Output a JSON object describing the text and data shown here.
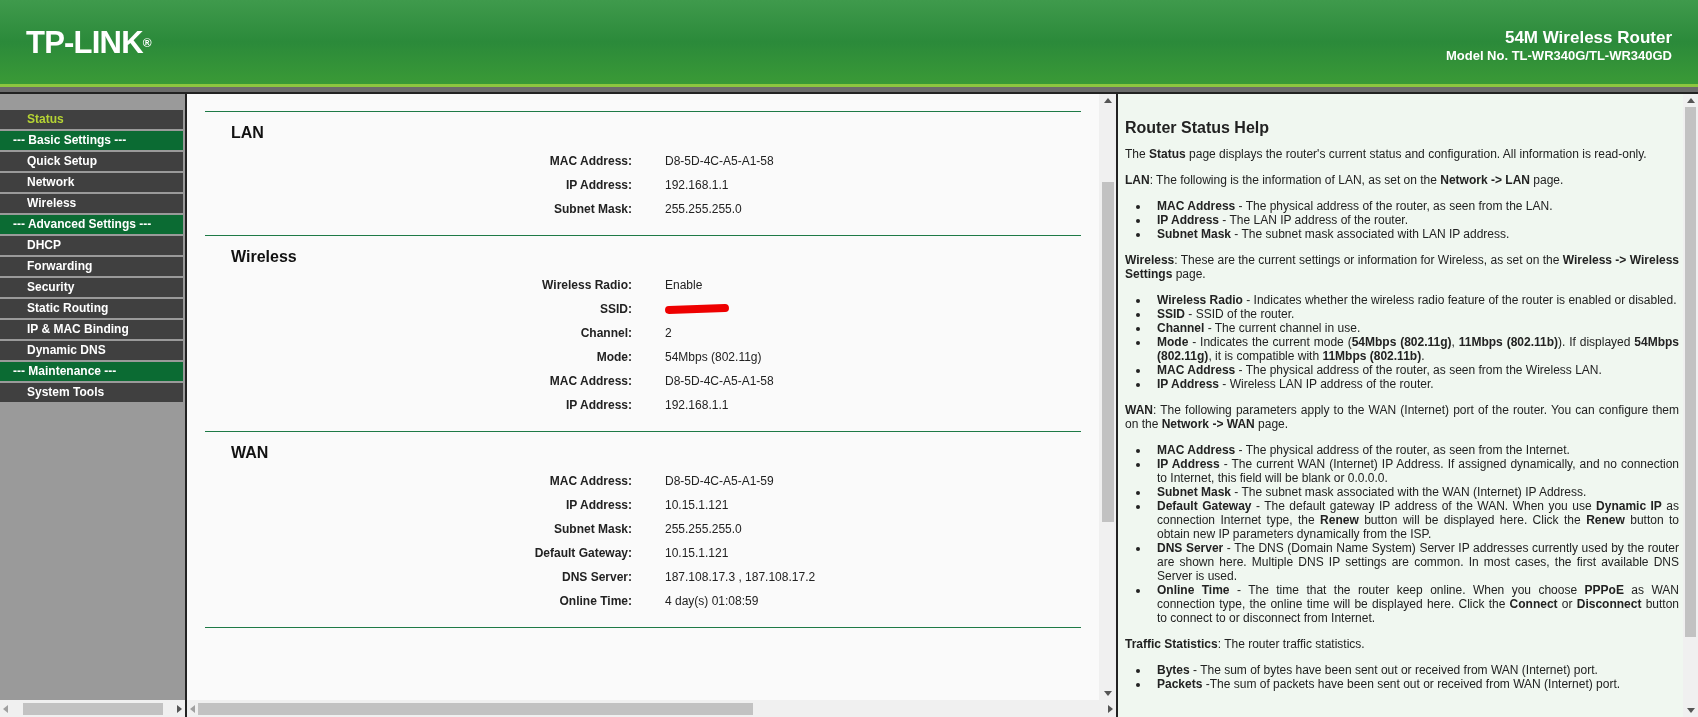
{
  "header": {
    "logo": "TP-LINK",
    "logo_mark": "®",
    "product": "54M Wireless Router",
    "model": "Model No. TL-WR340G/TL-WR340GD"
  },
  "sidebar": {
    "items": [
      {
        "label": "Status",
        "kind": "link",
        "selected": true
      },
      {
        "label": "--- Basic Settings ---",
        "kind": "heading",
        "selected": false
      },
      {
        "label": "Quick Setup",
        "kind": "link",
        "selected": false
      },
      {
        "label": "Network",
        "kind": "link",
        "selected": false
      },
      {
        "label": "Wireless",
        "kind": "link",
        "selected": false
      },
      {
        "label": "--- Advanced Settings ---",
        "kind": "heading",
        "selected": false
      },
      {
        "label": "DHCP",
        "kind": "link",
        "selected": false
      },
      {
        "label": "Forwarding",
        "kind": "link",
        "selected": false
      },
      {
        "label": "Security",
        "kind": "link",
        "selected": false
      },
      {
        "label": "Static Routing",
        "kind": "link",
        "selected": false
      },
      {
        "label": "IP & MAC Binding",
        "kind": "link",
        "selected": false
      },
      {
        "label": "Dynamic DNS",
        "kind": "link",
        "selected": false
      },
      {
        "label": "--- Maintenance ---",
        "kind": "heading",
        "selected": false
      },
      {
        "label": "System Tools",
        "kind": "link",
        "selected": false
      }
    ]
  },
  "main": {
    "sections": [
      {
        "title": "LAN",
        "rows": [
          {
            "label": "MAC Address:",
            "value": "D8-5D-4C-A5-A1-58",
            "redacted": false
          },
          {
            "label": "IP Address:",
            "value": "192.168.1.1",
            "redacted": false
          },
          {
            "label": "Subnet Mask:",
            "value": "255.255.255.0",
            "redacted": false
          }
        ]
      },
      {
        "title": "Wireless",
        "rows": [
          {
            "label": "Wireless Radio:",
            "value": "Enable",
            "redacted": false
          },
          {
            "label": "SSID:",
            "redacted": true
          },
          {
            "label": "Channel:",
            "value": "2",
            "redacted": false
          },
          {
            "label": "Mode:",
            "value": "54Mbps (802.11g)",
            "redacted": false
          },
          {
            "label": "MAC Address:",
            "value": "D8-5D-4C-A5-A1-58",
            "redacted": false
          },
          {
            "label": "IP Address:",
            "value": "192.168.1.1",
            "redacted": false
          }
        ]
      },
      {
        "title": "WAN",
        "rows": [
          {
            "label": "MAC Address:",
            "value": "D8-5D-4C-A5-A1-59",
            "redacted": false
          },
          {
            "label": "IP Address:",
            "value": "10.15.1.121",
            "redacted": false
          },
          {
            "label": "Subnet Mask:",
            "value": "255.255.255.0",
            "redacted": false
          },
          {
            "label": "Default Gateway:",
            "value": "10.15.1.121",
            "redacted": false
          },
          {
            "label": "DNS Server:",
            "value": "187.108.17.3 , 187.108.17.2",
            "redacted": false
          },
          {
            "label": "Online Time:",
            "value": "4 day(s) 01:08:59",
            "redacted": false
          }
        ]
      }
    ]
  },
  "help": {
    "title": "Router Status Help",
    "blocks": [
      {
        "kind": "paragraph",
        "text": "The **Status** page displays the router's current status and configuration. All information is read-only."
      },
      {
        "kind": "paragraph",
        "text": "**LAN**: The following is the information of LAN, as set on the **Network -> LAN** page."
      },
      {
        "kind": "list",
        "items": [
          "**MAC Address** - The physical address of the router, as seen from the LAN.",
          "**IP Address** - The LAN IP address of the router.",
          "**Subnet Mask** - The subnet mask associated with LAN IP address."
        ]
      },
      {
        "kind": "paragraph",
        "text": "**Wireless**: These are the current settings or information for Wireless, as set on the **Wireless -> Wireless Settings** page."
      },
      {
        "kind": "list",
        "items": [
          "**Wireless Radio** - Indicates whether the wireless radio feature of the router is enabled or disabled.",
          "**SSID** - SSID of the router.",
          "**Channel** - The current channel in use.",
          "**Mode** - Indicates the current mode (**54Mbps (802.11g)**, **11Mbps (802.11b)**). If displayed **54Mbps (802.11g)**, it is compatible with **11Mbps (802.11b)**.",
          "**MAC Address** - The physical address of the router, as seen from the Wireless LAN.",
          "**IP Address** - Wireless LAN IP address of the router."
        ]
      },
      {
        "kind": "paragraph",
        "text": "**WAN**: The following parameters apply to the WAN (Internet) port of the router. You can configure them on the **Network -> WAN** page."
      },
      {
        "kind": "list",
        "items": [
          "**MAC Address** - The physical address of the router, as seen from the Internet.",
          "**IP Address** - The current WAN (Internet) IP Address. If assigned dynamically, and no connection to Internet, this field will be blank or 0.0.0.0.",
          "**Subnet Mask** - The subnet mask associated with the WAN (Internet) IP Address.",
          "**Default Gateway** - The default gateway IP address of the WAN. When you use **Dynamic IP** as connection Internet type, the **Renew** button will be displayed here. Click the **Renew** button to obtain new IP parameters dynamically from the ISP.",
          "**DNS Server** - The DNS (Domain Name System) Server IP addresses currently used by the router are shown here. Multiple DNS IP settings are common. In most cases, the first available DNS Server is used.",
          "**Online Time** - The time that the router keep online. When you choose **PPPoE** as WAN connection type, the online time will be displayed here. Click the **Connect** or **Disconnect** button to connect to or disconnect from Internet."
        ]
      },
      {
        "kind": "paragraph",
        "text": "**Traffic Statistics**: The router traffic statistics."
      },
      {
        "kind": "list",
        "items": [
          "**Bytes** - The sum of bytes have been sent out or received from WAN (Internet) port.",
          "**Packets** -The sum of packets have been sent out or received from WAN (Internet) port."
        ]
      }
    ]
  }
}
